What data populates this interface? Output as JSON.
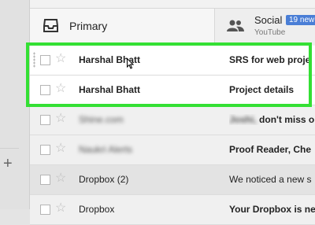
{
  "tabs": {
    "primary": {
      "label": "Primary",
      "icon": "inbox-icon"
    },
    "social": {
      "label": "Social",
      "subtitle": "YouTube",
      "badge": "19 new",
      "icon": "people-icon"
    }
  },
  "left_panel": {
    "add_icon": "+"
  },
  "emails": [
    {
      "sender": "Harshal Bhatt",
      "subject": "SRS for web proje",
      "unread": true,
      "highlighted": true
    },
    {
      "sender": "Harshal Bhatt",
      "subject": "Project details",
      "unread": true,
      "highlighted": true
    },
    {
      "sender": "Shine.com",
      "subject_prefix": "Joshi,",
      "subject": "don't miss o",
      "unread": false,
      "blurred_sender": true,
      "blurred_prefix": true
    },
    {
      "sender": "Naukri Alerts",
      "subject": "Proof Reader, Che",
      "unread": false,
      "blurred_sender": true
    },
    {
      "sender": "Dropbox (2)",
      "subject": "We noticed a new s",
      "unread": false,
      "grey": true
    },
    {
      "sender": "Dropbox",
      "subject": "Your Dropbox is ne",
      "unread": false
    }
  ],
  "colors": {
    "highlight": "#34e034",
    "badge": "#4a7ed6"
  }
}
